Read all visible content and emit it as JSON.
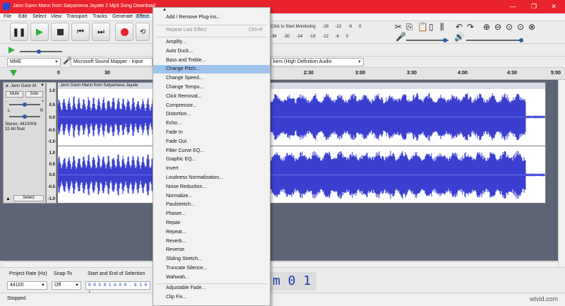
{
  "window": {
    "title": "Jann Gann Mann from Satyameva Jayate 2 Mp3 Song Download",
    "min_icon": "minimize-icon",
    "max_icon": "maximize-icon",
    "close_icon": "close-icon"
  },
  "menubar": {
    "items": [
      "File",
      "Edit",
      "Select",
      "View",
      "Transport",
      "Tracks",
      "Generate",
      "Effect"
    ],
    "active": "Effect"
  },
  "meter": {
    "monitoring": "Click to Start Monitoring",
    "top_ticks": [
      "-18",
      "-12",
      "-6",
      "0"
    ],
    "bottom_ticks": [
      "-36",
      "-30",
      "-24",
      "-18",
      "-12",
      "-6",
      "0"
    ]
  },
  "devices": {
    "host": "MME",
    "input": "Microsoft Sound Mapper - Input",
    "output": "kers (High Definition Audio"
  },
  "ruler": {
    "ticks": [
      "0",
      "30",
      "2:30",
      "3:00",
      "3:30",
      "4:00",
      "4:30",
      "5:00"
    ]
  },
  "track": {
    "name": "Jann Gann M",
    "clip_name": "Jann Gann Mann from Satyameva Jayate",
    "mute": "Mute",
    "solo": "Solo",
    "pan_left": "L",
    "pan_right": "R",
    "info_line1": "Stereo, 44100Hz",
    "info_line2": "32-bit float",
    "select": "Select",
    "scale_top": [
      "1.0",
      "0.5",
      "0.0",
      "-0.5",
      "-1.0"
    ],
    "scale_bottom": [
      "1.0",
      "0.5",
      "0.0",
      "-0.5",
      "-1.0"
    ]
  },
  "selection_bar": {
    "project_rate_label": "Project Rate (Hz)",
    "project_rate": "44100",
    "snap_label": "Snap-To",
    "snap": "Off",
    "selection_label": "Start and End of Selection",
    "selection_start": "0 0 h 0 1 m 0 0 . 6 1 0 s",
    "big_time": "m 0 1 s"
  },
  "status": {
    "text": "Stopped.",
    "watermark": "wtvid.com"
  },
  "effect_menu": {
    "add_remove": "Add / Remove Plug-ins...",
    "repeat_last": "Repeat Last Effect",
    "repeat_shortcut": "Ctrl+R",
    "items": [
      "Amplify...",
      "Auto Duck...",
      "Bass and Treble...",
      "Change Pitch...",
      "Change Speed...",
      "Change Tempo...",
      "Click Removal...",
      "Compressor...",
      "Distortion...",
      "Echo...",
      "Fade In",
      "Fade Out",
      "Filter Curve EQ...",
      "Graphic EQ...",
      "Invert",
      "Loudness Normalization...",
      "Noise Reduction...",
      "Normalize...",
      "Paulstretch...",
      "Phaser...",
      "Repair",
      "Repeat...",
      "Reverb...",
      "Reverse",
      "Sliding Stretch...",
      "Truncate Silence...",
      "Wahwah..."
    ],
    "highlighted": "Change Pitch...",
    "extra_items": [
      "Adjustable Fade...",
      "Clip Fix..."
    ]
  },
  "colors": {
    "titlebar": "#e8232e",
    "waveform": "#3a3fd0",
    "menu_highlight": "#9fc4ec"
  }
}
